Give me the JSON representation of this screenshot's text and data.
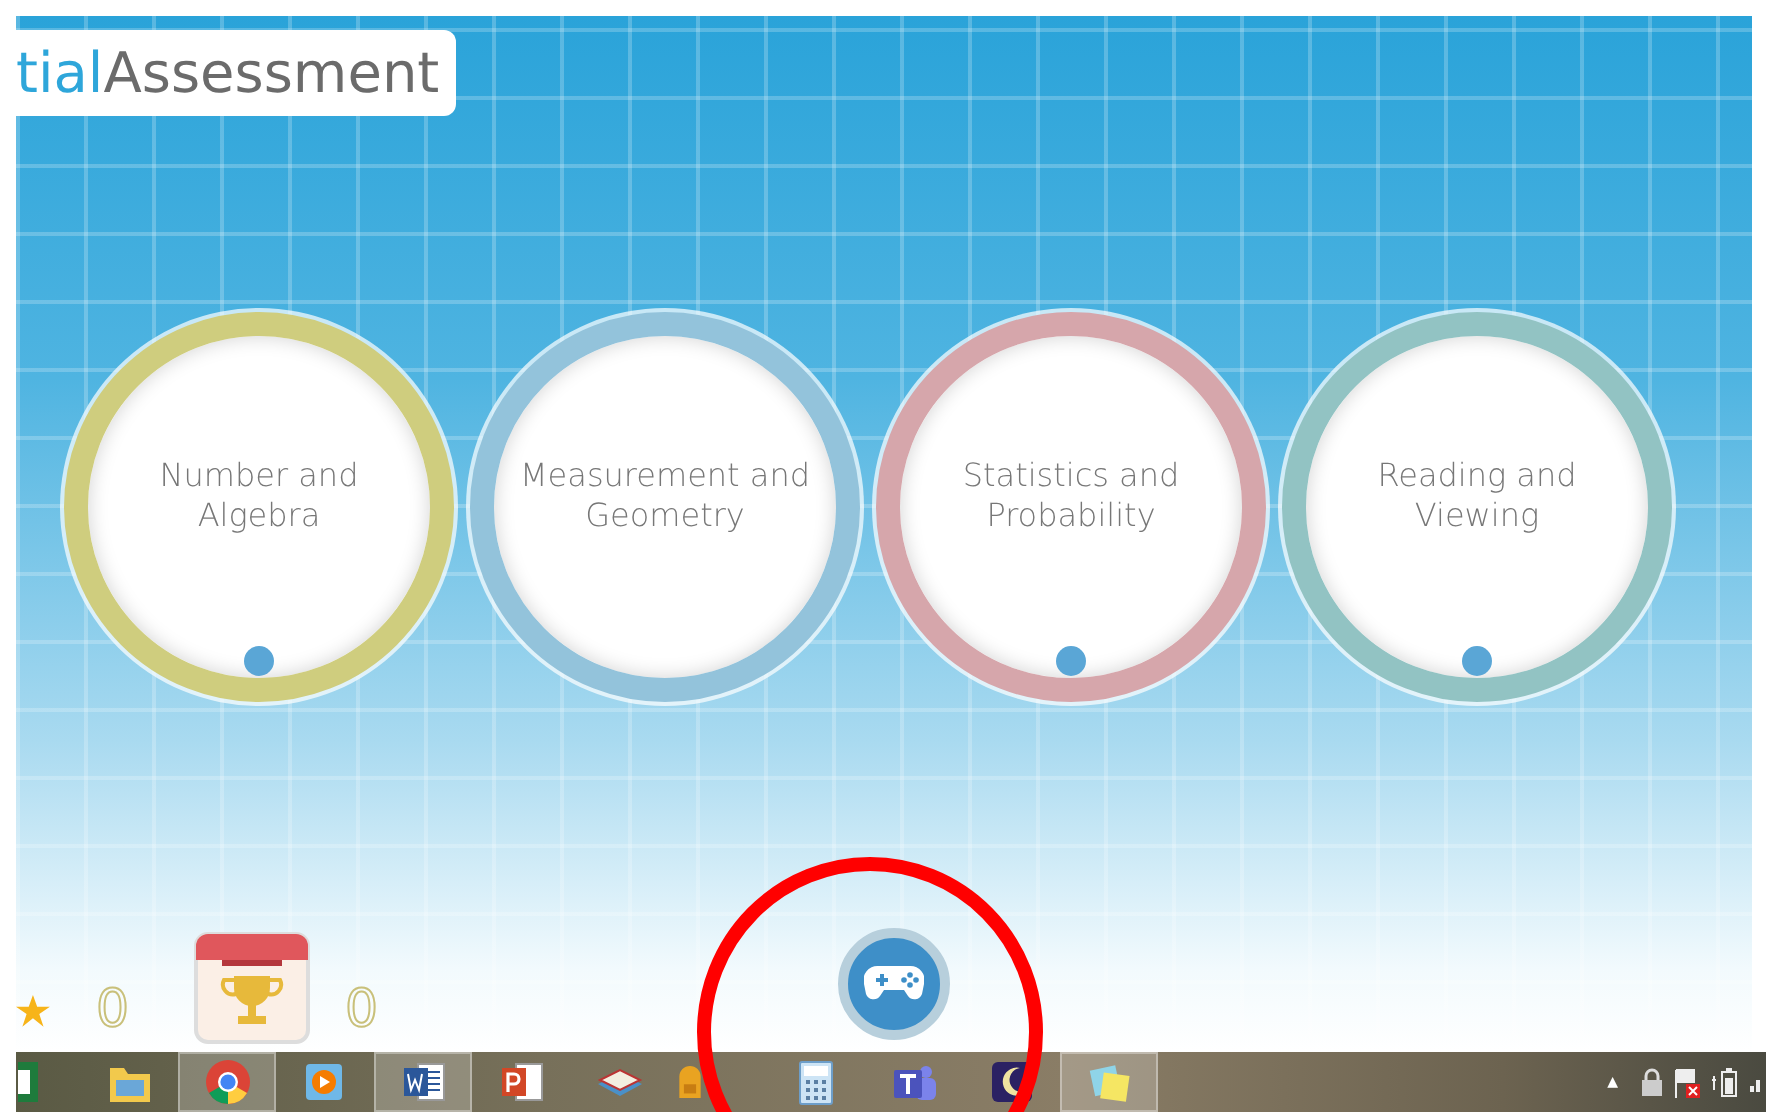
{
  "header": {
    "accent": "tial",
    "title": "Assessment"
  },
  "topics": [
    {
      "label": "Number and Algebra",
      "color": "#cfcd7e",
      "marker": true
    },
    {
      "label": "Measurement and Geometry",
      "color": "#93c3db",
      "marker": false
    },
    {
      "label": "Statistics and Probability",
      "color": "#d6a6ab",
      "marker": true
    },
    {
      "label": "Reading and Viewing",
      "color": "#92c3c3",
      "marker": true
    }
  ],
  "scores": {
    "stars": "0",
    "trophies": "0"
  },
  "taskbar": [
    {
      "kind": "sheet",
      "selected": false
    },
    {
      "kind": "folder",
      "selected": false
    },
    {
      "kind": "browser",
      "selected": true
    },
    {
      "kind": "player",
      "selected": false
    },
    {
      "kind": "word",
      "selected": true
    },
    {
      "kind": "slides",
      "selected": false
    },
    {
      "kind": "book",
      "selected": false
    },
    {
      "kind": "backpack",
      "selected": false
    },
    {
      "kind": "calculator",
      "selected": false
    },
    {
      "kind": "teams",
      "selected": false
    },
    {
      "kind": "night",
      "selected": false
    },
    {
      "kind": "notes",
      "selected": true
    }
  ],
  "tray": {
    "arrow": "▲"
  }
}
